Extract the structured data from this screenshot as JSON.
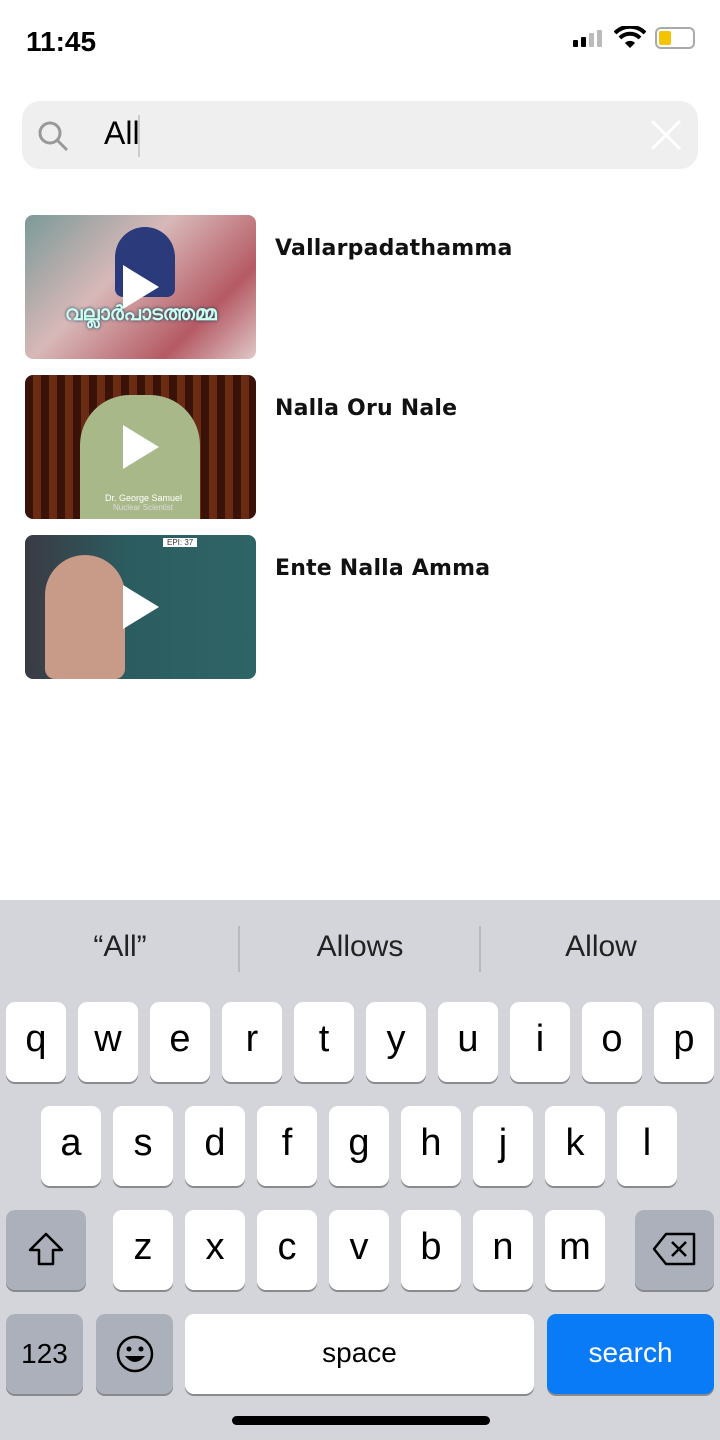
{
  "status": {
    "time": "11:45",
    "battery_color": "#f5c400"
  },
  "search": {
    "value": "All",
    "icons": [
      "search-icon",
      "clear-icon"
    ]
  },
  "results": [
    {
      "title": "Vallarpadathamma",
      "thumb_text": "വല്ലാർപാടത്തമ്മ"
    },
    {
      "title": "Nalla Oru Nale",
      "thumb_text": "Dr. George Samuel",
      "thumb_subtext": "Nuclear Scientist"
    },
    {
      "title": "Ente Nalla Amma",
      "thumb_text": "EPI: 37"
    }
  ],
  "keyboard": {
    "suggestions": [
      "“All”",
      "Allows",
      "Allow"
    ],
    "row1": [
      "q",
      "w",
      "e",
      "r",
      "t",
      "y",
      "u",
      "i",
      "o",
      "p"
    ],
    "row2": [
      "a",
      "s",
      "d",
      "f",
      "g",
      "h",
      "j",
      "k",
      "l"
    ],
    "row3": [
      "z",
      "x",
      "c",
      "v",
      "b",
      "n",
      "m"
    ],
    "numbers": "123",
    "space": "space",
    "search": "search",
    "accent_color": "#0a7bf7"
  }
}
